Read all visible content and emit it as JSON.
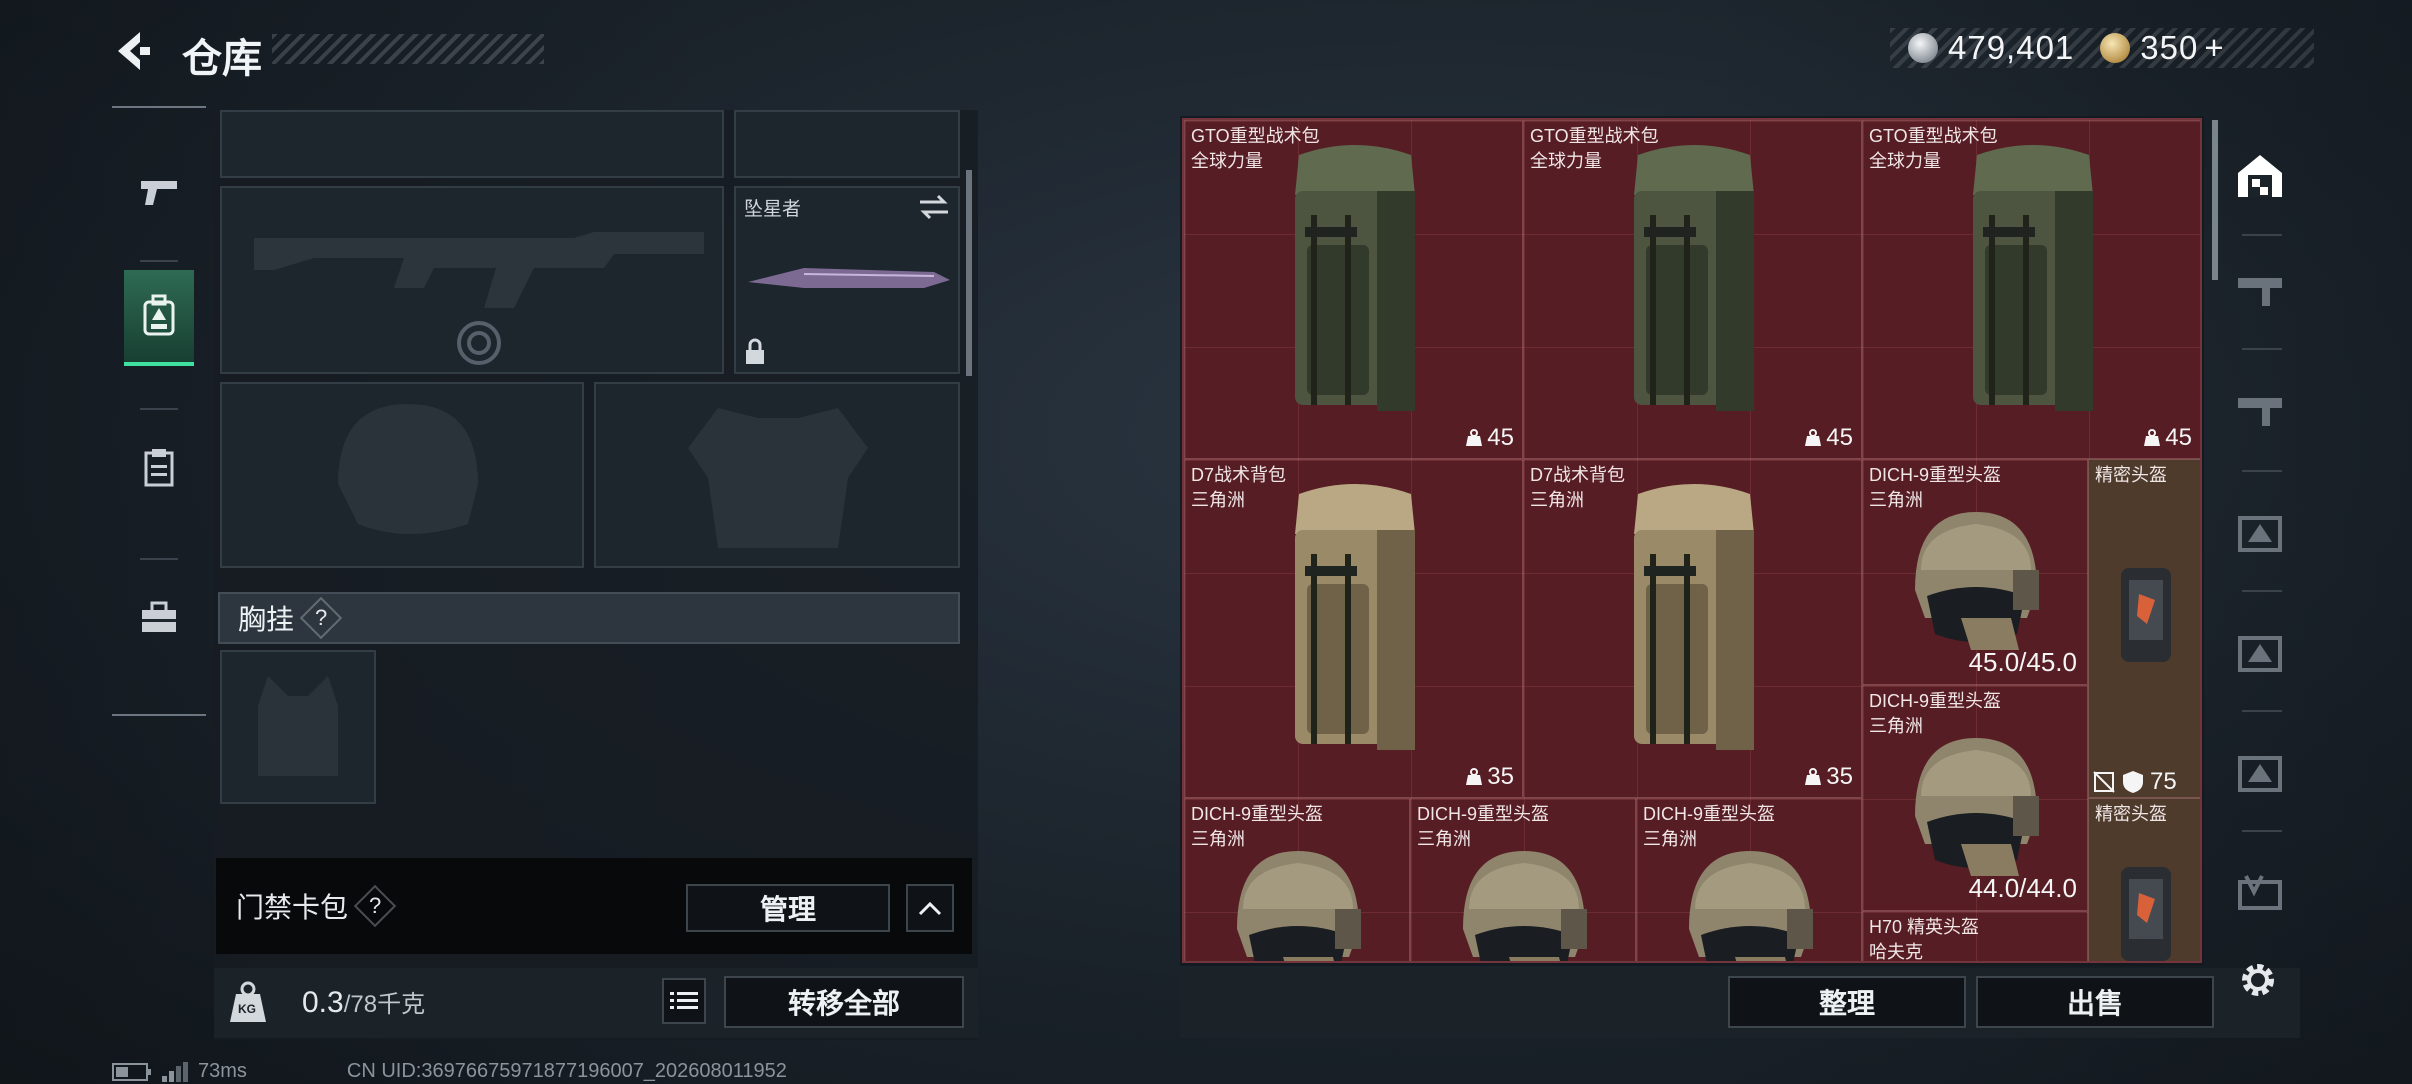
{
  "header": {
    "title": "仓库",
    "back_icon": "back-arrow-icon"
  },
  "currency": {
    "silver_icon": "silver-coin-icon",
    "silver_value": "479,401",
    "gold_icon": "gold-coin-icon",
    "gold_value": "350",
    "gold_plus": "+"
  },
  "left_nav": {
    "items": [
      {
        "icon": "pistol-icon",
        "active": false
      },
      {
        "icon": "backpack-equip-icon",
        "active": true
      },
      {
        "icon": "clipboard-icon",
        "active": false
      },
      {
        "icon": "toolbox-icon",
        "active": false
      }
    ]
  },
  "loadout": {
    "melee_slot_label": "坠星者",
    "swap_icon": "swap-arrows-icon",
    "lock_icon": "lock-icon",
    "chest_rig_section": "胸挂",
    "help_mark": "?"
  },
  "keycard": {
    "label": "门禁卡包",
    "help_mark": "?",
    "manage_button": "管理",
    "collapse_icon": "chevron-up-icon"
  },
  "weight": {
    "icon": "weight-kg-icon",
    "icon_text": "KG",
    "current": "0.3",
    "max": "/78千克",
    "list_icon": "list-icon",
    "transfer_all_button": "转移全部"
  },
  "storage_items": [
    {
      "name": "GTO重型战术包",
      "sub": "全球力量",
      "capacity": "45",
      "kind": "backpack-green"
    },
    {
      "name": "GTO重型战术包",
      "sub": "全球力量",
      "capacity": "45",
      "kind": "backpack-green"
    },
    {
      "name": "GTO重型战术包",
      "sub": "全球力量",
      "capacity": "45",
      "kind": "backpack-green"
    },
    {
      "name": "D7战术背包",
      "sub": "三角洲",
      "capacity": "35",
      "kind": "backpack-tan"
    },
    {
      "name": "D7战术背包",
      "sub": "三角洲",
      "capacity": "35",
      "kind": "backpack-tan"
    },
    {
      "name": "DICH-9重型头盔",
      "sub": "三角洲",
      "durability": "45.0/45.0",
      "kind": "helmet"
    },
    {
      "name": "精密头盔",
      "sub": "",
      "kind": "gadget"
    },
    {
      "name": "DICH-9重型头盔",
      "sub": "三角洲",
      "durability": "44.0/44.0",
      "kind": "helmet"
    },
    {
      "name": "DICH-9重型头盔",
      "sub": "三角洲",
      "kind": "helmet"
    },
    {
      "name": "DICH-9重型头盔",
      "sub": "三角洲",
      "kind": "helmet"
    },
    {
      "name": "DICH-9重型头盔",
      "sub": "三角洲",
      "kind": "helmet"
    },
    {
      "name": "精密头盔",
      "sub": "",
      "kind": "gadget"
    },
    {
      "name": "H70 精英头盔",
      "sub": "哈夫克",
      "kind": "helmet"
    }
  ],
  "armor_badge": {
    "no_insure_icon": "no-insurance-icon",
    "shield_icon": "shield-icon",
    "value": "75"
  },
  "capacity_icon": "weight-bag-icon",
  "right_nav": {
    "items": [
      "warehouse-home-icon",
      "storage-rack-1-icon",
      "storage-rack-2-icon",
      "storage-rack-3-icon",
      "storage-rack-4-icon",
      "storage-rack-5-icon",
      "storage-rack-6-icon"
    ]
  },
  "bottom_actions": {
    "sort_button": "整理",
    "sell_button": "出售",
    "settings_icon": "gear-icon"
  },
  "status": {
    "battery_icon": "battery-icon",
    "signal_icon": "signal-icon",
    "ping": "73ms",
    "uid": "CN UID:3697667597187719600​7_202608011952"
  }
}
